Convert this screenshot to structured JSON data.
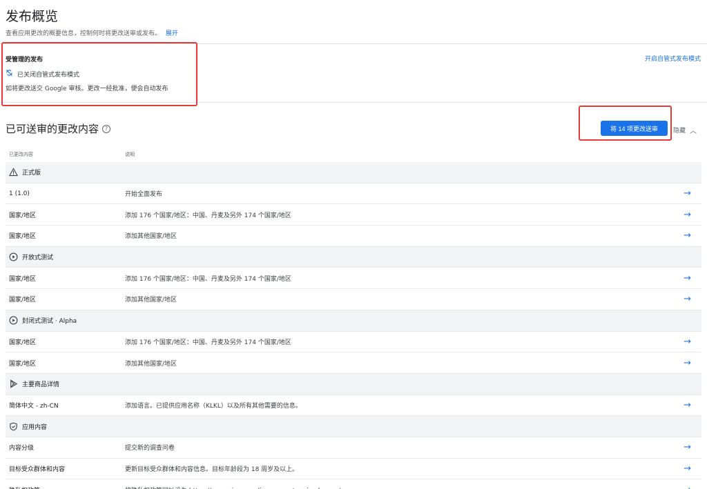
{
  "header": {
    "title": "发布概览",
    "subtitle": "查看应用更改的概要信息，控制何时将更改送审或发布。",
    "expand_link": "展开"
  },
  "managed": {
    "title": "受管理的发布",
    "status": "已关闭自管式发布模式",
    "desc": "如将更改送交 Google 审核。更改一经批准，便会自动发布",
    "enable_link": "开启自管式发布模式"
  },
  "changes": {
    "title": "已可送审的更改内容",
    "send_button": "将 14 项更改送审",
    "hide_label": "隐藏",
    "col_changed": "已更改内容",
    "col_desc": "说明"
  },
  "rows": [
    {
      "type": "group",
      "icon": "warning-triangle-icon",
      "label": "正式版"
    },
    {
      "type": "item",
      "label": "1 (1.0)",
      "desc": "开始全面发布"
    },
    {
      "type": "item",
      "label": "国家/地区",
      "desc": "添加 176 个国家/地区：中国、丹麦及另外 174 个国家/地区"
    },
    {
      "type": "item",
      "label": "国家/地区",
      "desc": "添加其他国家/地区"
    },
    {
      "type": "group",
      "icon": "play-circle-icon",
      "label": "开放式测试"
    },
    {
      "type": "item",
      "label": "国家/地区",
      "desc": "添加 176 个国家/地区：中国、丹麦及另外 174 个国家/地区"
    },
    {
      "type": "item",
      "label": "国家/地区",
      "desc": "添加其他国家/地区"
    },
    {
      "type": "group",
      "icon": "play-circle-icon",
      "label": "封闭式测试 · Alpha"
    },
    {
      "type": "item",
      "label": "国家/地区",
      "desc": "添加 176 个国家/地区：中国、丹麦及另外 174 个国家/地区"
    },
    {
      "type": "item",
      "label": "国家/地区",
      "desc": "添加其他国家/地区"
    },
    {
      "type": "group",
      "icon": "play-store-icon",
      "label": "主要商品详情"
    },
    {
      "type": "item",
      "label": "简体中文 - zh-CN",
      "desc": "添加语言。已提供应用名称（KLKL）以及所有其他需要的信息。"
    },
    {
      "type": "group",
      "icon": "shield-icon",
      "label": "应用内容"
    },
    {
      "type": "item",
      "label": "内容分级",
      "desc": "提交新的调查问卷"
    },
    {
      "type": "item",
      "label": "目标受众群体和内容",
      "desc": "更新目标受众群体和内容信息。目标年龄段为 18 周岁及以上。"
    },
    {
      "type": "item",
      "label": "隐私权政策",
      "desc": "将隐私权政策网址设为 https://app-privacy-policy-generator.nisrulz.com/"
    }
  ],
  "colors": {
    "accent": "#1a73e8",
    "highlight": "#e53935"
  }
}
